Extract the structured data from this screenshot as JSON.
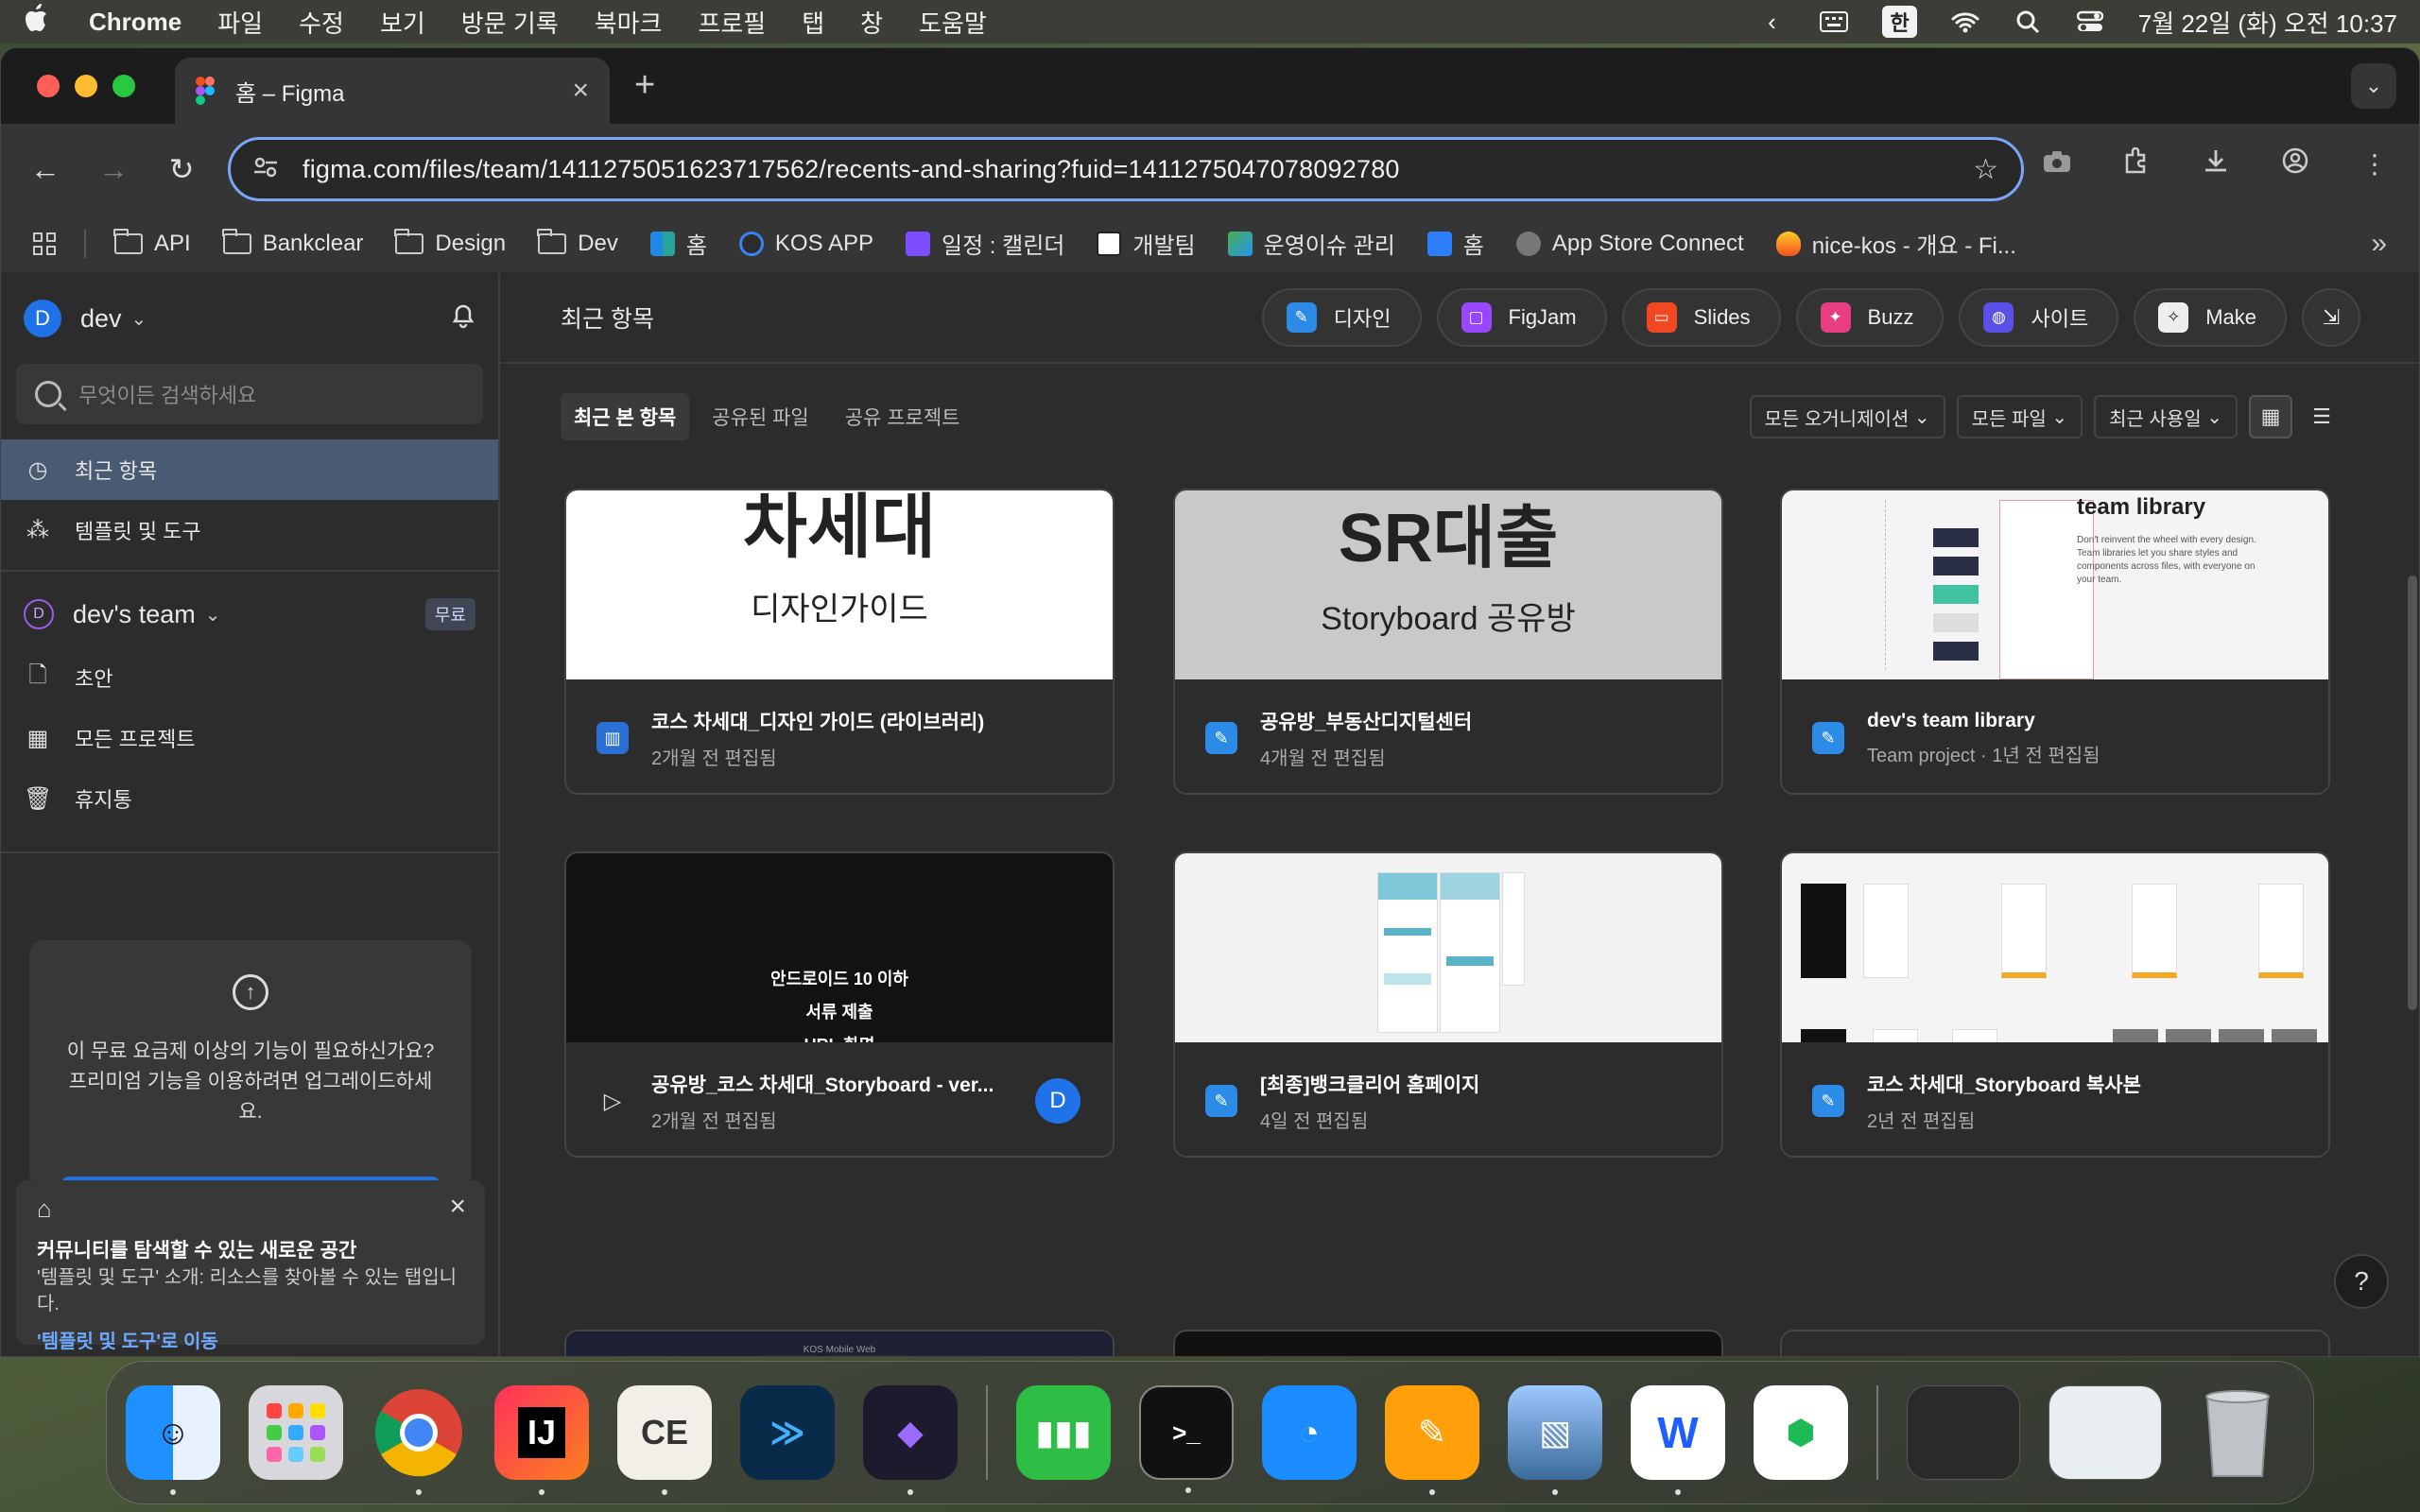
{
  "menubar": {
    "app": "Chrome",
    "items": [
      "파일",
      "수정",
      "보기",
      "방문 기록",
      "북마크",
      "프로필",
      "탭",
      "창",
      "도움말"
    ],
    "ime": "한",
    "datetime": "7월 22일 (화) 오전 10:37"
  },
  "browser": {
    "tab_title": "홈 – Figma",
    "url": "figma.com/files/team/1411275051623717562/recents-and-sharing?fuid=1411275047078092780",
    "bookmarks": [
      "API",
      "Bankclear",
      "Design",
      "Dev",
      "홈",
      "KOS APP",
      "일정 : 캘린더",
      "개발팀",
      "운영이슈 관리",
      "홈",
      "App Store Connect",
      "nice-kos - 개요 - Fi..."
    ]
  },
  "sidebar": {
    "user": "dev",
    "user_initial": "D",
    "search_placeholder": "무엇이든 검색하세요",
    "nav": [
      {
        "label": "최근 항목",
        "icon": "clock-icon"
      },
      {
        "label": "템플릿 및 도구",
        "icon": "templates-icon"
      }
    ],
    "team": {
      "name": "dev's team",
      "initial": "D",
      "badge": "무료"
    },
    "team_nav": [
      {
        "label": "초안",
        "icon": "file-icon"
      },
      {
        "label": "모든 프로젝트",
        "icon": "grid-icon"
      },
      {
        "label": "휴지통",
        "icon": "trash-icon"
      }
    ],
    "upgrade_text": "이 무료 요금제 이상의 기능이 필요하신가요? 프리미엄 기능을 이용하려면 업그레이드하세요.",
    "community": {
      "title": "커뮤니티를 탐색할 수 있는 새로운 공간",
      "body": "'템플릿 및 도구' 소개: 리소스를 찾아볼 수 있는 탭입니다.",
      "link": "'템플릿 및 도구'로 이동"
    }
  },
  "main": {
    "title": "최근 항목",
    "create_buttons": [
      "디자인",
      "FigJam",
      "Slides",
      "Buzz",
      "사이트",
      "Make"
    ],
    "filter_tabs": [
      "최근 본 항목",
      "공유된 파일",
      "공유 프로젝트"
    ],
    "dropdowns": [
      "모든 오거니제이션",
      "모든 파일",
      "최근 사용일"
    ],
    "files": [
      {
        "title": "코스 차세대_디자인 가이드 (라이브러리)",
        "sub": "2개월 전 편집됨",
        "thumb_big": "차세대",
        "thumb_small": "디자인가이드"
      },
      {
        "title": "공유방_부동산디지털센터",
        "sub": "4개월 전 편집됨",
        "thumb_big": "SR대출",
        "thumb_small": "Storyboard 공유방"
      },
      {
        "title": "dev's team library",
        "sub": "Team project · 1년 전 편집됨",
        "thumb_big": "team library",
        "thumb_small": "Don't reinvent the wheel with every design. Team libraries let you share styles and components across files, with everyone on your team."
      },
      {
        "title": "공유방_코스 차세대_Storyboard - ver...",
        "sub": "2개월 전 편집됨",
        "thumb_lines": [
          "안드로이드 10 이하",
          "서류 제출",
          "URL 화면"
        ],
        "owner": "D"
      },
      {
        "title": "[최종]뱅크클리어 홈페이지",
        "sub": "4일 전 편집됨"
      },
      {
        "title": "코스 차세대_Storyboard 복사본",
        "sub": "2년 전 편집됨"
      }
    ],
    "partial_thumb_text": "KOS Mobile Web"
  },
  "colors": {
    "accent": "#1f72e8",
    "focus": "#7aa6f7",
    "active_nav": "#4a5a73"
  }
}
